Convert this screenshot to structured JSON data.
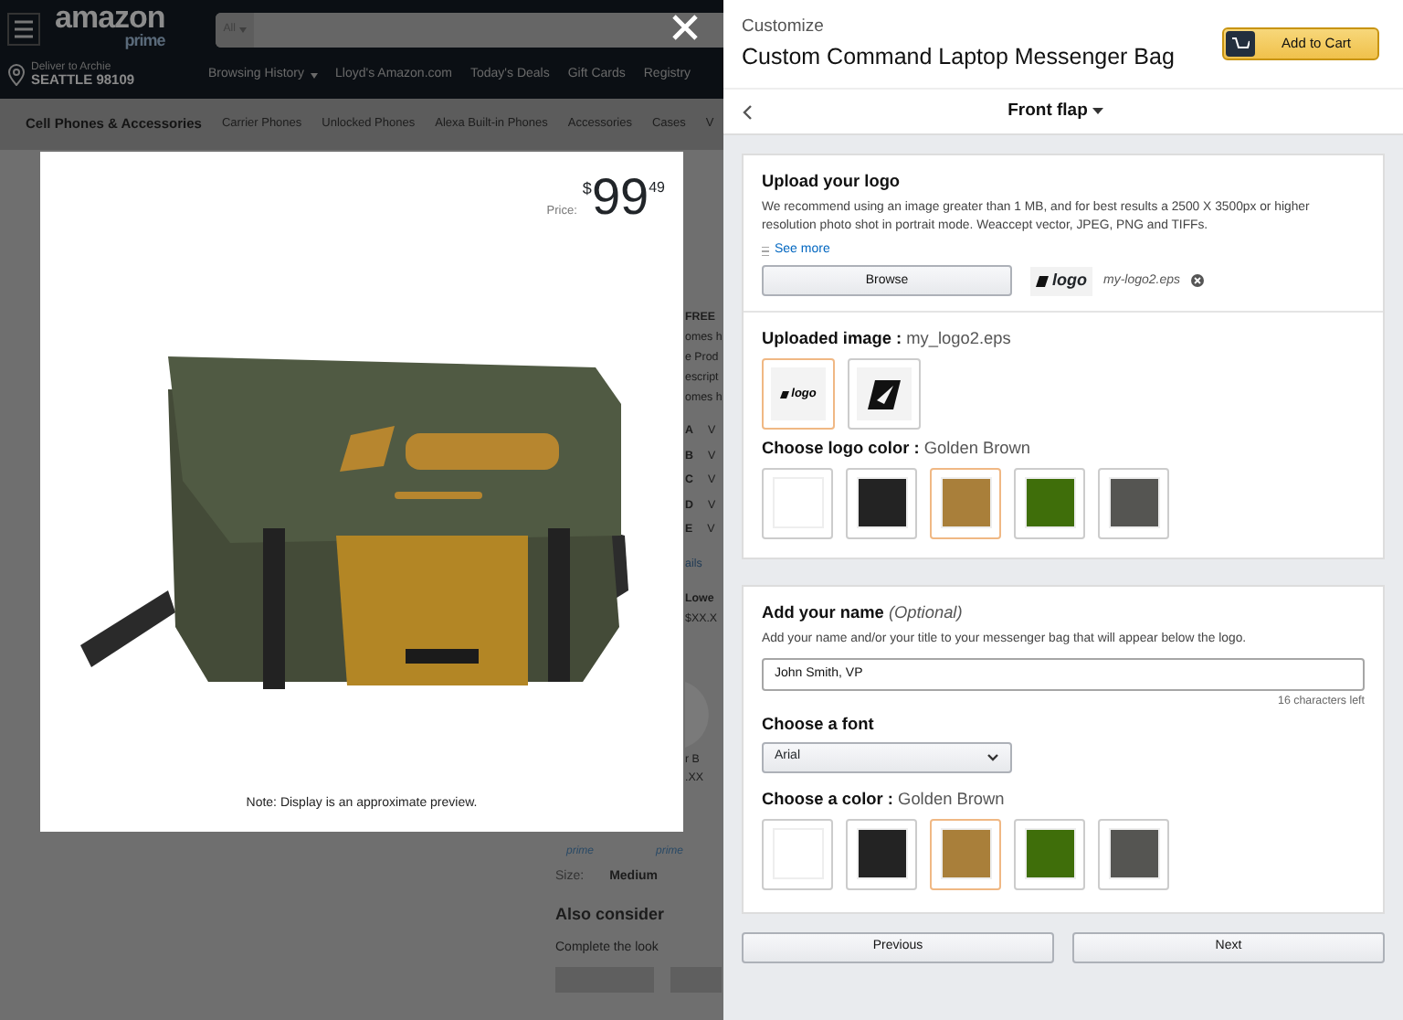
{
  "header": {
    "logo": "amazon",
    "logo_sub": "prime",
    "search_scope": "All",
    "deliver_to": "Deliver to Archie",
    "location": "SEATTLE 98109",
    "links": [
      "Browsing History",
      "Lloyd's Amazon.com",
      "Today's Deals",
      "Gift Cards",
      "Registry"
    ]
  },
  "category_nav": {
    "title": "Cell Phones & Accessories",
    "links": [
      "Carrier Phones",
      "Unlocked Phones",
      "Alexa Built-in Phones",
      "Accessories",
      "Cases",
      "V"
    ]
  },
  "product_column": {
    "shipping": "FREE",
    "lines": [
      "omes h",
      "e Prod",
      "escript",
      "omes h"
    ],
    "variants": [
      {
        "letter": "A",
        "text": "V"
      },
      {
        "letter": "B",
        "text": "V"
      },
      {
        "letter": "C",
        "text": "V"
      },
      {
        "letter": "D",
        "text": "V"
      },
      {
        "letter": "E",
        "text": "V"
      }
    ],
    "details_link": "ails",
    "lowest": "Lowe",
    "lowest_price": "$XX.X",
    "option": "r B",
    "option_price": ".XX",
    "badges": [
      "prime",
      "prime"
    ],
    "size_label": "Size:",
    "size_value": "Medium",
    "also_consider": "Also consider",
    "complete_look": "Complete the look"
  },
  "preview": {
    "price_label": "Price:",
    "currency": "$",
    "price_whole": "99",
    "price_fraction": "49",
    "note": "Note: Display is an approximate preview."
  },
  "customizer": {
    "eyebrow": "Customize",
    "title": "Custom Command Laptop Messenger Bag",
    "cart_button": "Add to Cart",
    "step": "Front flap",
    "upload": {
      "heading": "Upload your logo",
      "text": "We recommend using an image greater than 1 MB, and for best results a 2500 X 3500px or higher resolution photo shot in portrait mode. Weaccept vector, JPEG, PNG and TIFFs.",
      "see_more": "See more",
      "browse": "Browse",
      "file_logo": "logo",
      "file_name": "my-logo2.eps"
    },
    "uploaded": {
      "label": "Uploaded image :",
      "value": "my_logo2.eps",
      "thumbs": [
        {
          "kind": "wordmark",
          "text": "logo",
          "selected": true
        },
        {
          "kind": "symbol",
          "selected": false
        }
      ]
    },
    "logo_color": {
      "label": "Choose logo color :",
      "value": "Golden Brown",
      "swatches": [
        {
          "color": "#ffffff",
          "selected": false
        },
        {
          "color": "#232323",
          "selected": false
        },
        {
          "color": "#a97f3a",
          "selected": true
        },
        {
          "color": "#3f6e0a",
          "selected": false
        },
        {
          "color": "#555552",
          "selected": false
        }
      ]
    },
    "name": {
      "heading": "Add your name",
      "optional": "(Optional)",
      "hint": "Add your name and/or your title to your messenger bag that will appear below the logo.",
      "value": "John Smith, VP",
      "counter": "16 characters left"
    },
    "font": {
      "label": "Choose a font",
      "value": "Arial"
    },
    "text_color": {
      "label": "Choose a color :",
      "value": "Golden Brown",
      "swatches": [
        {
          "color": "#ffffff",
          "selected": false
        },
        {
          "color": "#232323",
          "selected": false
        },
        {
          "color": "#a97f3a",
          "selected": true
        },
        {
          "color": "#3f6e0a",
          "selected": false
        },
        {
          "color": "#555552",
          "selected": false
        }
      ]
    },
    "buttons": [
      "Previous",
      "Next"
    ]
  }
}
